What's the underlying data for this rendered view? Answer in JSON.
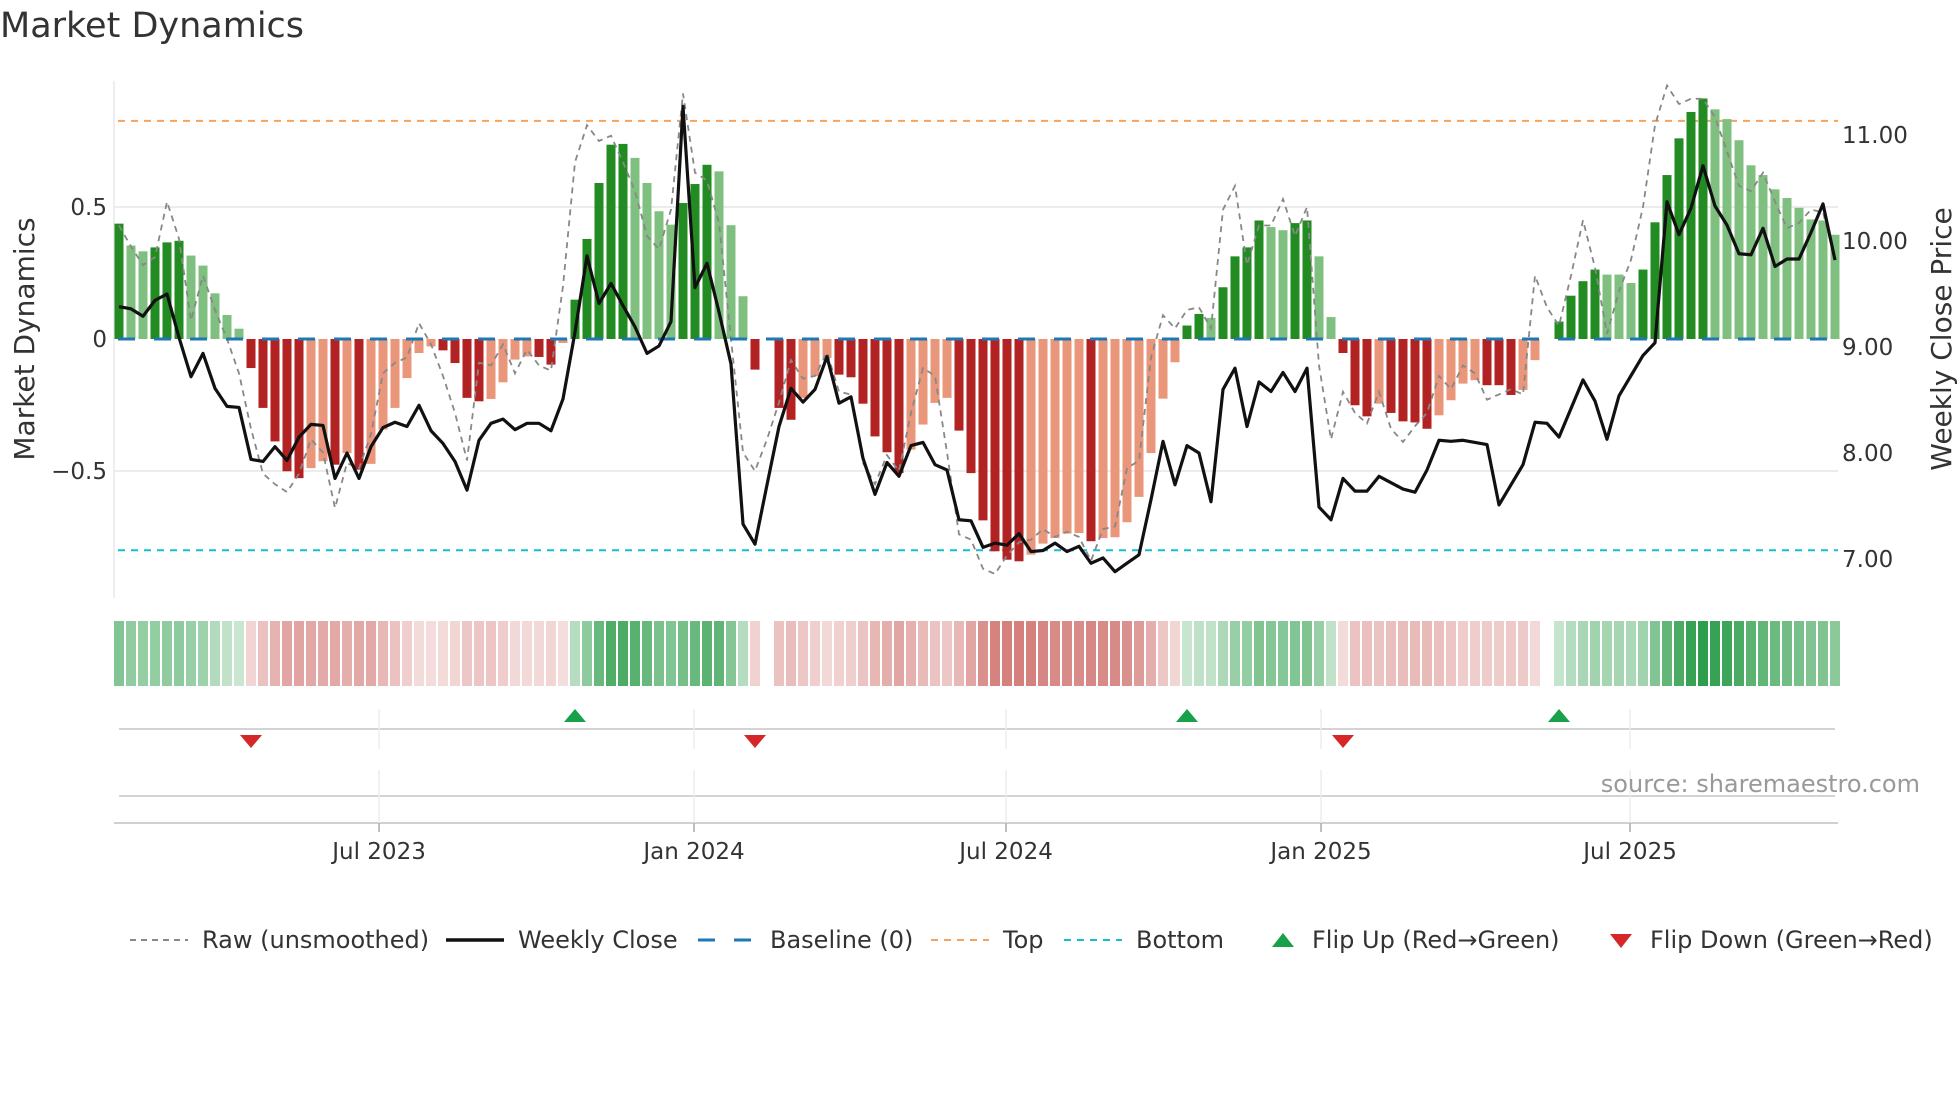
{
  "title": "Market Dynamics",
  "source": "source: sharemaestro.com",
  "colors": {
    "pos_strong": "#228b22",
    "pos_weak": "#7fbf7f",
    "neg_strong": "#b22222",
    "neg_weak": "#e9967a",
    "close": "#111111",
    "raw": "#888888",
    "baseline": "#1f77b4",
    "top": "#f4a460",
    "bottom": "#17becf",
    "flip_up": "#18a04a",
    "flip_down": "#d62728"
  },
  "chart_data": {
    "type": "bar+line",
    "title": "Market Dynamics",
    "ylabel_left": "Market Dynamics",
    "ylabel_right": "Weekly Close Price",
    "ylim_left": [
      -0.98,
      0.98
    ],
    "ylim_right": [
      6.63,
      11.51
    ],
    "yticks_left": [
      {
        "v": 0.5,
        "label": "0.5"
      },
      {
        "v": 0,
        "label": "0"
      },
      {
        "v": -0.5,
        "label": "−0.5"
      }
    ],
    "yticks_right": [
      {
        "v": 11,
        "label": "11.00"
      },
      {
        "v": 10,
        "label": "10.00"
      },
      {
        "v": 9,
        "label": "9.00"
      },
      {
        "v": 8,
        "label": "8.00"
      },
      {
        "v": 7,
        "label": "7.00"
      }
    ],
    "xticks": [
      {
        "week": 21.67,
        "label": "Jul 2023"
      },
      {
        "week": 47.92,
        "label": "Jan 2024"
      },
      {
        "week": 73.92,
        "label": "Jul 2024"
      },
      {
        "week": 100.17,
        "label": "Jan 2025"
      },
      {
        "week": 125.92,
        "label": "Jul 2025"
      }
    ],
    "top_level": 0.826,
    "bottom_level": -0.8,
    "baseline": 0,
    "dynamics": [
      0.437,
      0.354,
      0.332,
      0.347,
      0.366,
      0.372,
      0.316,
      0.278,
      0.173,
      0.091,
      0.039,
      -0.11,
      -0.261,
      -0.388,
      -0.501,
      -0.527,
      -0.489,
      -0.463,
      -0.476,
      -0.432,
      -0.495,
      -0.473,
      -0.343,
      -0.261,
      -0.148,
      -0.053,
      -0.028,
      -0.043,
      -0.091,
      -0.223,
      -0.236,
      -0.227,
      -0.164,
      -0.078,
      -0.066,
      -0.068,
      -0.097,
      -0.015,
      0.149,
      0.379,
      0.591,
      0.736,
      0.739,
      0.686,
      0.591,
      0.484,
      0.433,
      0.515,
      0.587,
      0.66,
      0.635,
      0.431,
      0.162,
      -0.116,
      0,
      -0.261,
      -0.306,
      -0.223,
      -0.141,
      -0.072,
      -0.135,
      -0.145,
      -0.245,
      -0.369,
      -0.429,
      -0.508,
      -0.419,
      -0.324,
      -0.242,
      -0.223,
      -0.347,
      -0.508,
      -0.687,
      -0.804,
      -0.836,
      -0.842,
      -0.817,
      -0.775,
      -0.754,
      -0.737,
      -0.735,
      -0.766,
      -0.754,
      -0.751,
      -0.694,
      -0.598,
      -0.432,
      -0.226,
      -0.088,
      0.051,
      0.095,
      0.08,
      0.196,
      0.313,
      0.347,
      0.449,
      0.424,
      0.412,
      0.439,
      0.449,
      0.313,
      0.083,
      -0.053,
      -0.251,
      -0.293,
      -0.245,
      -0.28,
      -0.312,
      -0.316,
      -0.34,
      -0.289,
      -0.232,
      -0.169,
      -0.156,
      -0.175,
      -0.175,
      -0.212,
      -0.193,
      -0.08,
      0,
      0.066,
      0.164,
      0.219,
      0.263,
      0.244,
      0.244,
      0.212,
      0.263,
      0.442,
      0.621,
      0.76,
      0.86,
      0.911,
      0.87,
      0.833,
      0.753,
      0.658,
      0.621,
      0.567,
      0.534,
      0.497,
      0.453,
      0.449,
      0.395
    ],
    "strength": "DLLDDDLLLLLDDDDDLLDLDLLLLLLDDDDLLLLDDLDDDDDLLLLDDDLLLDLDDLLLDDDDDDLLLLDDDDDDLLLLLDLLLLLLLDDLDDDDLLDDLLDDDLDDDDLLLLDDDLLLDDDDLLLDDDDDDLLLLLLLLLLL",
    "raw": [
      0.43,
      0.35,
      0.28,
      0.31,
      0.52,
      0.38,
      0.07,
      0.24,
      0.11,
      0,
      -0.13,
      -0.34,
      -0.51,
      -0.55,
      -0.58,
      -0.51,
      -0.38,
      -0.43,
      -0.64,
      -0.47,
      -0.49,
      -0.36,
      -0.13,
      -0.09,
      -0.07,
      0.06,
      -0.02,
      -0.14,
      -0.28,
      -0.46,
      -0.09,
      -0.1,
      -0.02,
      -0.13,
      -0.04,
      -0.1,
      -0.12,
      0.2,
      0.67,
      0.81,
      0.75,
      0.77,
      0.67,
      0.56,
      0.39,
      0.34,
      0.49,
      0.93,
      0.63,
      0.6,
      0.44,
      0,
      -0.43,
      -0.5,
      -0.38,
      -0.24,
      -0.08,
      -0.15,
      -0.14,
      -0.05,
      -0.2,
      -0.21,
      -0.47,
      -0.55,
      -0.44,
      -0.5,
      -0.28,
      -0.11,
      -0.14,
      -0.43,
      -0.74,
      -0.76,
      -0.87,
      -0.89,
      -0.82,
      -0.77,
      -0.76,
      -0.72,
      -0.75,
      -0.73,
      -0.75,
      -0.84,
      -0.72,
      -0.71,
      -0.49,
      -0.46,
      -0.07,
      0.09,
      0.04,
      0.11,
      0.12,
      0.04,
      0.49,
      0.58,
      0.28,
      0.43,
      0.43,
      0.53,
      0.39,
      0.5,
      -0.1,
      -0.38,
      -0.2,
      -0.28,
      -0.32,
      -0.2,
      -0.34,
      -0.39,
      -0.33,
      -0.28,
      -0.14,
      -0.19,
      -0.1,
      -0.13,
      -0.23,
      -0.21,
      -0.19,
      -0.21,
      0.24,
      0.12,
      0.05,
      0.24,
      0.45,
      0.27,
      0.02,
      0.18,
      0.3,
      0.5,
      0.81,
      0.96,
      0.89,
      0.91,
      0.91,
      0.84,
      0.71,
      0.58,
      0.56,
      0.63,
      0.52,
      0.42,
      0.44,
      0.49,
      0.48,
      0.3
    ],
    "weekly_close": [
      9.38,
      9.36,
      9.29,
      9.44,
      9.5,
      9.09,
      8.72,
      8.94,
      8.61,
      8.44,
      8.43,
      7.94,
      7.92,
      8.06,
      7.93,
      8.15,
      8.27,
      8.26,
      7.76,
      8.0,
      7.76,
      8.06,
      8.24,
      8.29,
      8.25,
      8.45,
      8.21,
      8.09,
      7.92,
      7.65,
      8.12,
      8.28,
      8.32,
      8.22,
      8.28,
      8.28,
      8.21,
      8.51,
      9.14,
      9.86,
      9.41,
      9.6,
      9.39,
      9.19,
      8.94,
      9.01,
      9.24,
      11.27,
      9.56,
      9.79,
      9.33,
      8.84,
      7.33,
      7.14,
      7.7,
      8.25,
      8.61,
      8.48,
      8.6,
      8.91,
      8.47,
      8.53,
      7.95,
      7.61,
      7.91,
      7.78,
      8.07,
      8.1,
      7.89,
      7.84,
      7.37,
      7.36,
      7.11,
      7.15,
      7.13,
      7.24,
      7.07,
      7.08,
      7.15,
      7.07,
      7.12,
      6.96,
      7.01,
      6.88,
      6.96,
      7.04,
      7.56,
      8.11,
      7.7,
      8.07,
      8.0,
      7.54,
      8.6,
      8.8,
      8.25,
      8.67,
      8.58,
      8.76,
      8.58,
      8.8,
      7.49,
      7.37,
      7.76,
      7.64,
      7.64,
      7.78,
      7.72,
      7.66,
      7.63,
      7.84,
      8.12,
      8.11,
      8.12,
      8.1,
      8.08,
      7.51,
      7.7,
      7.89,
      8.29,
      8.28,
      8.15,
      8.42,
      8.69,
      8.49,
      8.13,
      8.54,
      8.73,
      8.92,
      9.04,
      10.37,
      10.06,
      10.31,
      10.71,
      10.33,
      10.15,
      9.88,
      9.87,
      10.12,
      9.76,
      9.83,
      9.83,
      10.08,
      10.35,
      9.82
    ],
    "flip_up_weeks": [
      38,
      89,
      120
    ],
    "flip_down_weeks": [
      11,
      53,
      102
    ],
    "legend": {
      "placement": "bottom",
      "items": [
        {
          "key": "raw",
          "label": "Raw (unsmoothed)"
        },
        {
          "key": "close",
          "label": "Weekly Close"
        },
        {
          "key": "baseline",
          "label": "Baseline (0)"
        },
        {
          "key": "top",
          "label": "Top"
        },
        {
          "key": "bottom",
          "label": "Bottom"
        },
        {
          "key": "flip_up",
          "label": "Flip Up (Red→Green)"
        },
        {
          "key": "flip_down",
          "label": "Flip Down (Green→Red)"
        }
      ]
    }
  }
}
